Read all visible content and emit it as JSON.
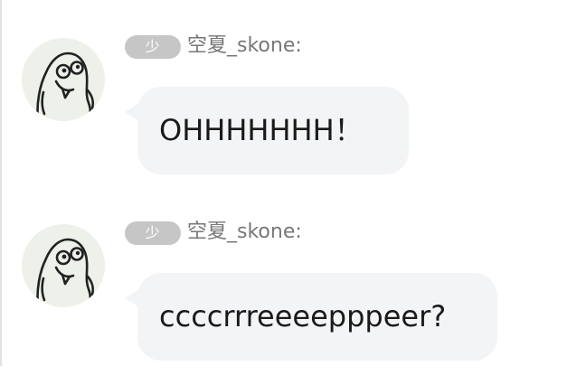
{
  "messages": [
    {
      "badge": "少",
      "username": "空夏_skone:",
      "text": "OHHHHHHH！",
      "avatar_icon": "cartoon-smiling-face-avatar"
    },
    {
      "badge": "少",
      "username": "空夏_skone:",
      "text": "ccccrrreeeepppeer?",
      "avatar_icon": "cartoon-smiling-face-avatar"
    }
  ],
  "colors": {
    "bubble": "#f3f4f6",
    "badge": "#c6c6c6",
    "username": "#777777",
    "text": "#1a1a1a",
    "avatar_bg": "#eef1ea"
  }
}
